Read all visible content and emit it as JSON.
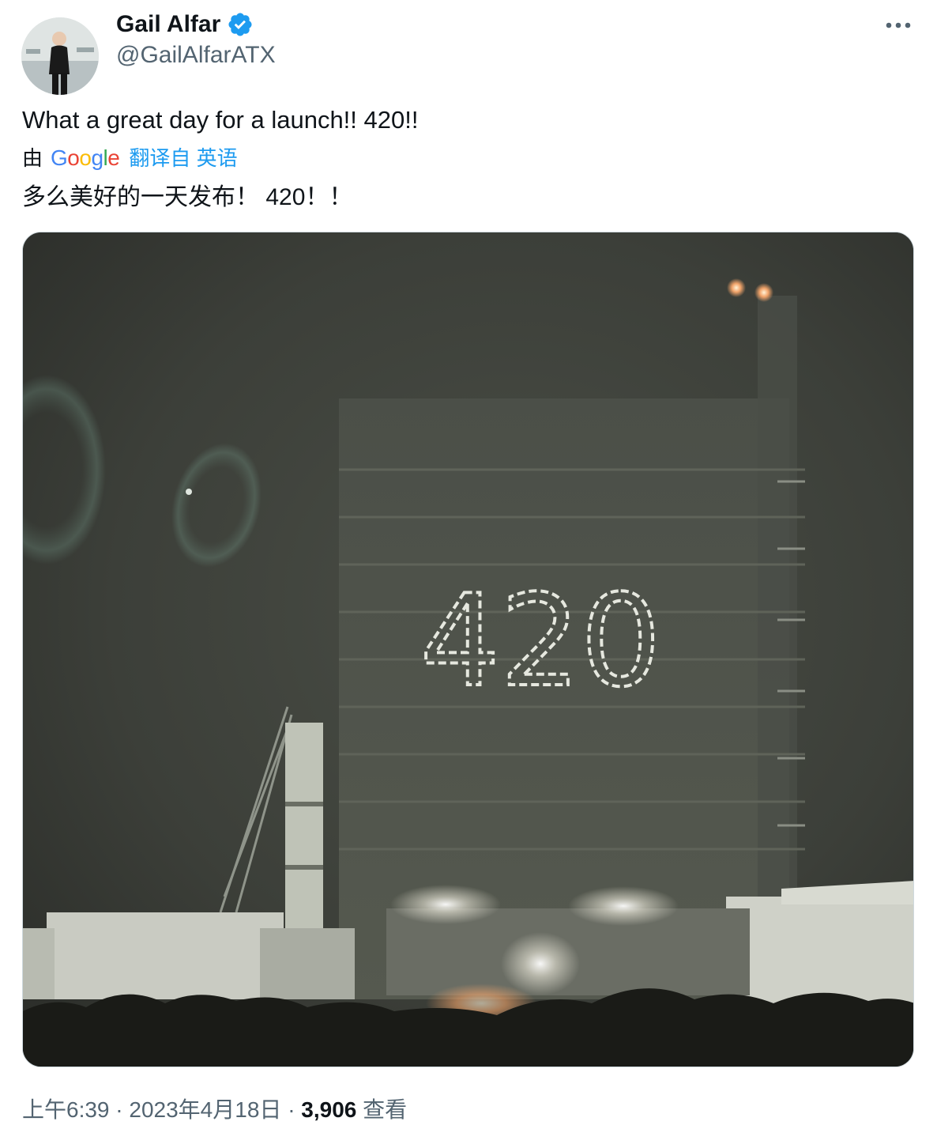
{
  "author": {
    "name": "Gail Alfar",
    "handle": "@GailAlfarATX",
    "verified": true,
    "verified_color": "#1d9bf0"
  },
  "tweet": {
    "text": "What a great day for a launch!! 420!!",
    "translation": {
      "by_label": "由",
      "provider": "Google",
      "link_label": "翻译自 英语",
      "text": "多么美好的一天发布！ 420！！"
    }
  },
  "media": {
    "overlay_text": "420"
  },
  "meta": {
    "time": "上午6:39",
    "separator": "·",
    "date": "2023年4月18日",
    "views_count": "3,906",
    "views_label": "查看"
  },
  "icons": {
    "verified": "verified-badge-icon",
    "more": "more-options-icon"
  },
  "colors": {
    "text_primary": "#0f1419",
    "text_secondary": "#536471",
    "link": "#1d9bf0"
  }
}
